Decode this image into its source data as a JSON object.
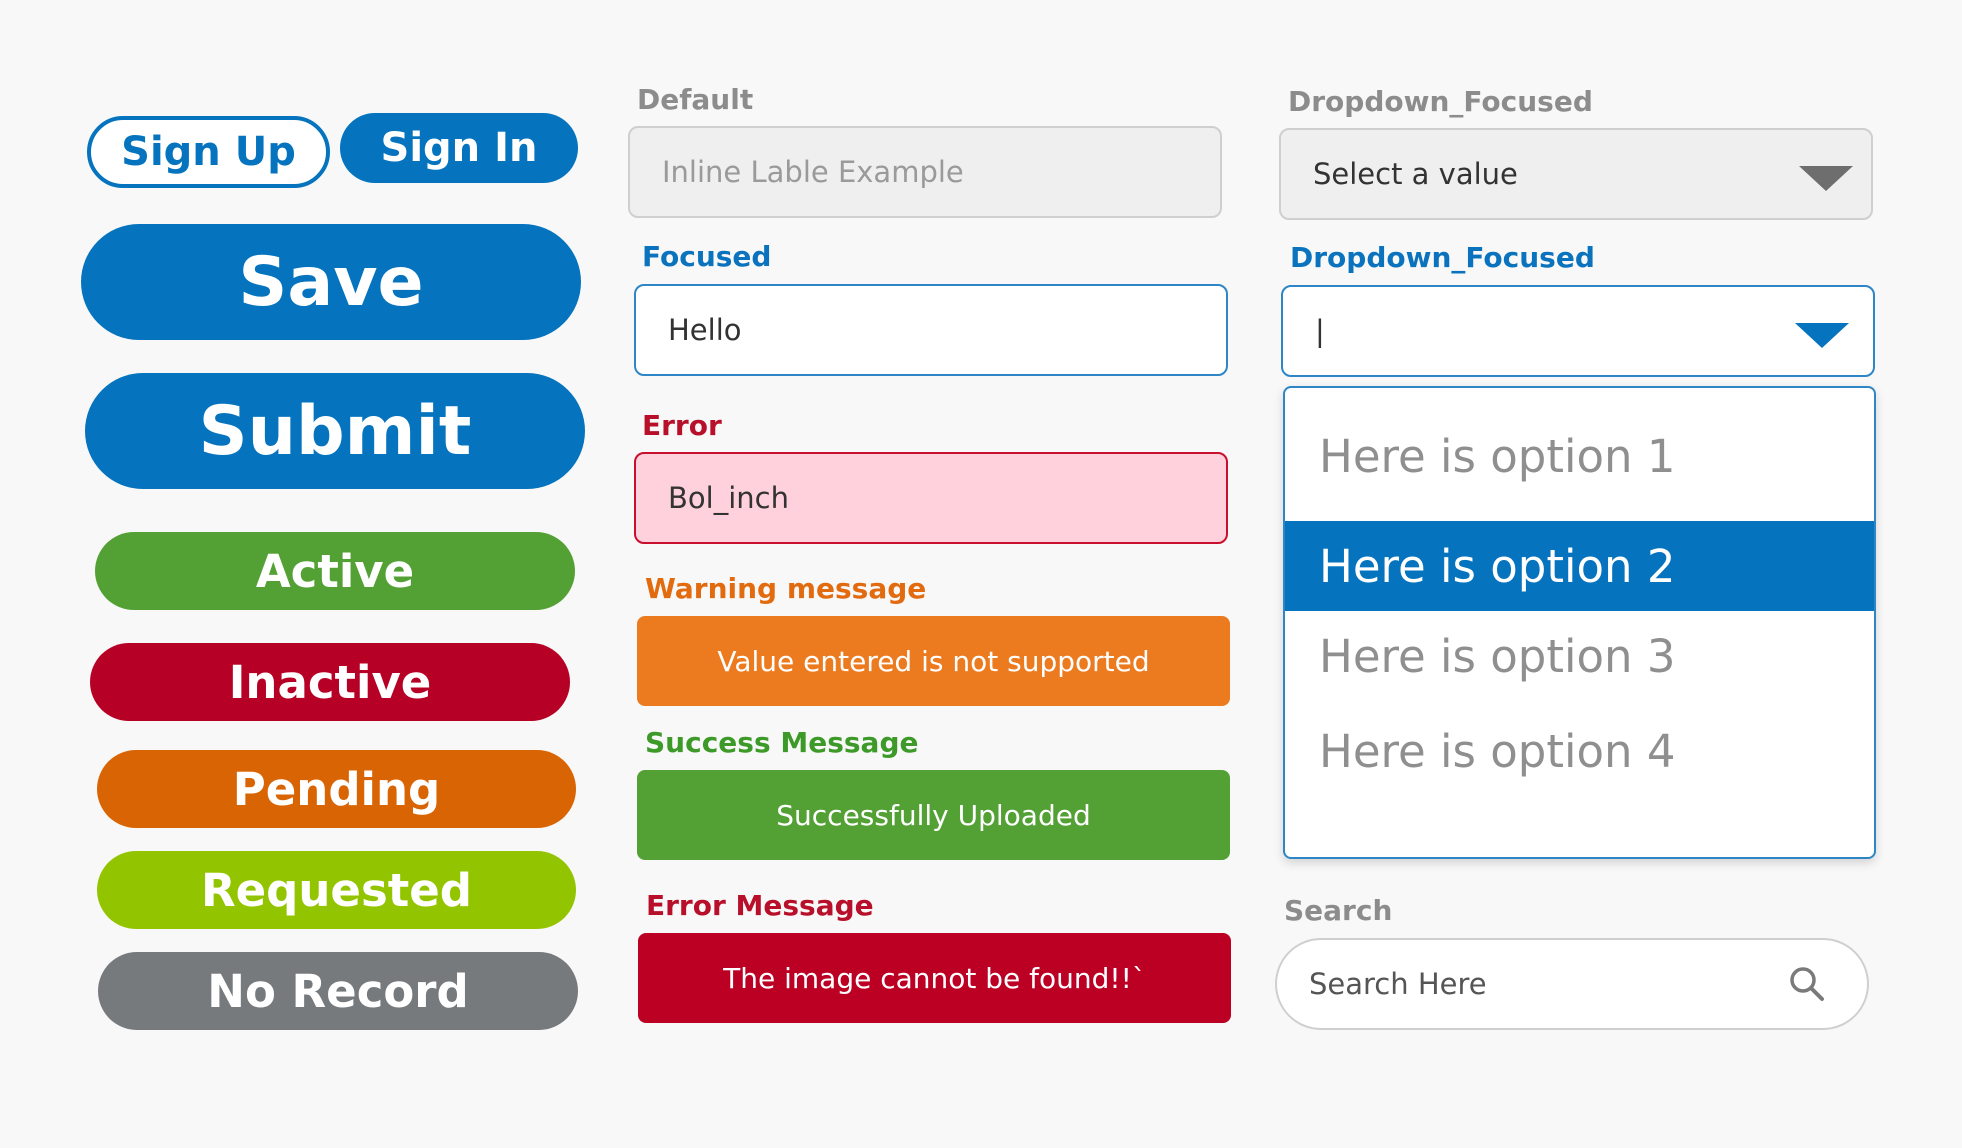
{
  "buttons": {
    "sign_up": "Sign Up",
    "sign_in": "Sign In",
    "save": "Save",
    "submit": "Submit",
    "active": "Active",
    "inactive": "Inactive",
    "pending": "Pending",
    "requested": "Requested",
    "no_record": "No Record"
  },
  "fields": {
    "default_label": "Default",
    "default_value": "Inline Lable Example",
    "focused_label": "Focused",
    "focused_value": "Hello",
    "error_label": "Error",
    "error_value": "Bol_inch"
  },
  "messages": {
    "warning_label": "Warning message",
    "warning_text": "Value entered is not supported",
    "success_label": "Success Message",
    "success_text": "Successfully Uploaded",
    "error_label": "Error Message",
    "error_text": "The image cannot be found!!`"
  },
  "dropdowns": {
    "default_label": "Dropdown_Focused",
    "default_value": "Select a value",
    "focused_label": "Dropdown_Focused",
    "focused_value": "|",
    "options": [
      "Here is option 1",
      "Here is option 2",
      "Here is option 3",
      "Here is option 4"
    ]
  },
  "search": {
    "label": "Search",
    "placeholder": "Search Here"
  },
  "colors": {
    "primary": "#0573bd",
    "active": "#53a134",
    "inactive": "#b70026",
    "pending": "#d96403",
    "requested": "#92c500",
    "no_record": "#767a7d",
    "warning": "#ec7a1f",
    "success": "#53a134",
    "error": "#bb0024"
  },
  "icons": {
    "dropdown_caret": "chevron-down-icon",
    "search": "search-icon"
  }
}
